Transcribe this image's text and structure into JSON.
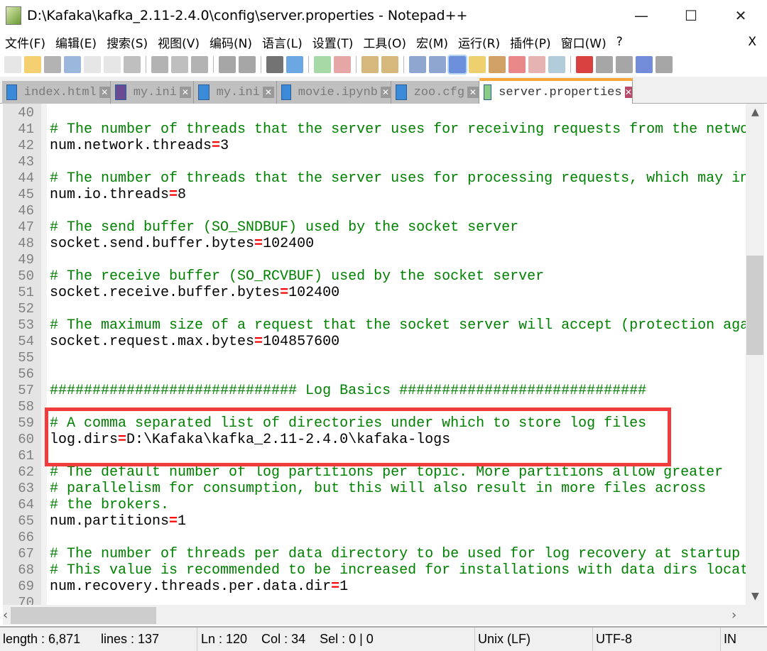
{
  "window": {
    "title": "D:\\Kafaka\\kafka_2.11-2.4.0\\config\\server.properties - Notepad++",
    "minimize": "—",
    "maximize": "☐",
    "close": "✕"
  },
  "menu": [
    "文件(F)",
    "编辑(E)",
    "搜索(S)",
    "视图(V)",
    "编码(N)",
    "语言(L)",
    "设置(T)",
    "工具(O)",
    "宏(M)",
    "运行(R)",
    "插件(P)",
    "窗口(W)",
    "?"
  ],
  "menu_close": "X",
  "toolbar": [
    "new",
    "open",
    "save",
    "save-all",
    "close",
    "close-all",
    "print",
    "cut",
    "copy",
    "paste",
    "undo",
    "redo",
    "find",
    "replace",
    "zoom-in",
    "zoom-out",
    "sync-v",
    "sync-h",
    "wrap",
    "show-all",
    "indent-guide",
    "udl",
    "doc-map",
    "function-list",
    "folder",
    "monitor",
    "record",
    "stop",
    "play",
    "run-multiple",
    "save-macro"
  ],
  "tabs": [
    {
      "label": "index.html",
      "active": false
    },
    {
      "label": "my.ini",
      "active": false
    },
    {
      "label": "my.ini",
      "active": false
    },
    {
      "label": "movie.ipynb",
      "active": false
    },
    {
      "label": "zoo.cfg",
      "active": false
    },
    {
      "label": "server.properties",
      "active": true
    }
  ],
  "colors": {
    "comment": "#008000",
    "operator": "#ff0000",
    "highlight_box": "#f03c3c",
    "active_tab": "#f9a73a"
  },
  "lines": [
    {
      "n": "40",
      "t": "",
      "k": ""
    },
    {
      "n": "41",
      "t": "# The number of threads that the server uses for receiving requests from the netwo",
      "k": "c"
    },
    {
      "n": "42",
      "t": "num.network.threads",
      "v": "3",
      "k": "kv"
    },
    {
      "n": "43",
      "t": "",
      "k": ""
    },
    {
      "n": "44",
      "t": "# The number of threads that the server uses for processing requests, which may in",
      "k": "c"
    },
    {
      "n": "45",
      "t": "num.io.threads",
      "v": "8",
      "k": "kv"
    },
    {
      "n": "46",
      "t": "",
      "k": ""
    },
    {
      "n": "47",
      "t": "# The send buffer (SO_SNDBUF) used by the socket server",
      "k": "c"
    },
    {
      "n": "48",
      "t": "socket.send.buffer.bytes",
      "v": "102400",
      "k": "kv"
    },
    {
      "n": "49",
      "t": "",
      "k": ""
    },
    {
      "n": "50",
      "t": "# The receive buffer (SO_RCVBUF) used by the socket server",
      "k": "c"
    },
    {
      "n": "51",
      "t": "socket.receive.buffer.bytes",
      "v": "102400",
      "k": "kv"
    },
    {
      "n": "52",
      "t": "",
      "k": ""
    },
    {
      "n": "53",
      "t": "# The maximum size of a request that the socket server will accept (protection aga",
      "k": "c"
    },
    {
      "n": "54",
      "t": "socket.request.max.bytes",
      "v": "104857600",
      "k": "kv"
    },
    {
      "n": "55",
      "t": "",
      "k": ""
    },
    {
      "n": "56",
      "t": "",
      "k": ""
    },
    {
      "n": "57",
      "t": "############################# Log Basics #############################",
      "k": "c"
    },
    {
      "n": "58",
      "t": "",
      "k": ""
    },
    {
      "n": "59",
      "t": "# A comma separated list of directories under which to store log files",
      "k": "c"
    },
    {
      "n": "60",
      "t": "log.dirs",
      "v": "D:\\Kafaka\\kafka_2.11-2.4.0\\kafaka-logs",
      "k": "kv"
    },
    {
      "n": "61",
      "t": "",
      "k": ""
    },
    {
      "n": "62",
      "t": "# The default number of log partitions per topic. More partitions allow greater",
      "k": "c"
    },
    {
      "n": "63",
      "t": "# parallelism for consumption, but this will also result in more files across",
      "k": "c"
    },
    {
      "n": "64",
      "t": "# the brokers.",
      "k": "c"
    },
    {
      "n": "65",
      "t": "num.partitions",
      "v": "1",
      "k": "kv"
    },
    {
      "n": "66",
      "t": "",
      "k": ""
    },
    {
      "n": "67",
      "t": "# The number of threads per data directory to be used for log recovery at startup",
      "k": "c"
    },
    {
      "n": "68",
      "t": "# This value is recommended to be increased for installations with data dirs locat",
      "k": "c"
    },
    {
      "n": "69",
      "t": "num.recovery.threads.per.data.dir",
      "v": "1",
      "k": "kv"
    },
    {
      "n": "70",
      "t": "",
      "k": ""
    }
  ],
  "status": {
    "length": "length : 6,871",
    "lines": "lines : 137",
    "pos": "Ln : 120    Col : 34    Sel : 0 | 0",
    "eol": "Unix (LF)",
    "enc": "UTF-8",
    "mode": "IN"
  }
}
